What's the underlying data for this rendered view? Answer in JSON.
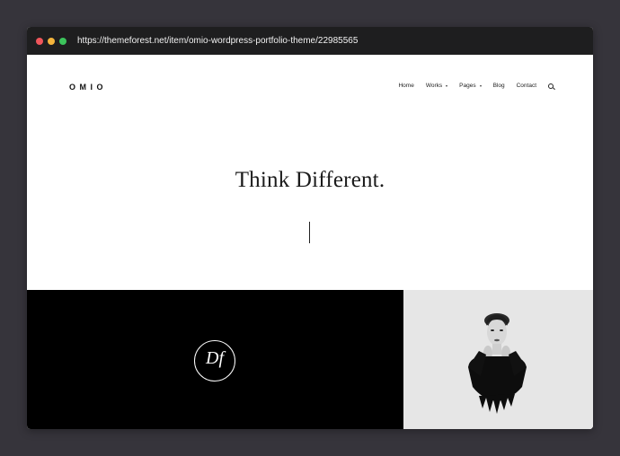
{
  "browser": {
    "url": "https://themeforest.net/item/omio-wordpress-portfolio-theme/22985565"
  },
  "site": {
    "logo": "OMIO",
    "nav": [
      {
        "label": "Home",
        "has_dropdown": false
      },
      {
        "label": "Works",
        "has_dropdown": true
      },
      {
        "label": "Pages",
        "has_dropdown": true
      },
      {
        "label": "Blog",
        "has_dropdown": false
      },
      {
        "label": "Contact",
        "has_dropdown": false
      }
    ],
    "search_icon": "search-icon"
  },
  "hero": {
    "title": "Think Different."
  },
  "portfolio": {
    "items": [
      {
        "icon": "df-monogram-logo",
        "background": "#000000"
      },
      {
        "icon": "woman-portrait",
        "background": "#e6e6e6"
      }
    ]
  },
  "colors": {
    "desktop_bg": "#36343b",
    "titlebar_bg": "#1e1e1f",
    "close_dot": "#f0565b",
    "minimize_dot": "#f4b43c",
    "maximize_dot": "#3cc45c"
  }
}
